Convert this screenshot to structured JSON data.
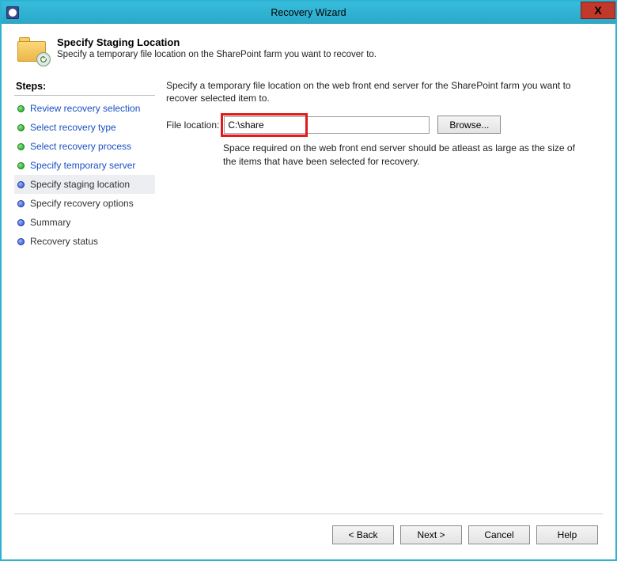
{
  "window": {
    "title": "Recovery Wizard",
    "close": "X"
  },
  "header": {
    "title": "Specify Staging Location",
    "subtitle": "Specify a temporary file location on the SharePoint farm you want to recover to."
  },
  "sidebar": {
    "heading": "Steps:",
    "items": [
      {
        "label": "Review recovery selection",
        "state": "done"
      },
      {
        "label": "Select recovery type",
        "state": "done"
      },
      {
        "label": "Select recovery process",
        "state": "done"
      },
      {
        "label": "Specify temporary server",
        "state": "done"
      },
      {
        "label": "Specify staging location",
        "state": "current"
      },
      {
        "label": "Specify recovery options",
        "state": "pending"
      },
      {
        "label": "Summary",
        "state": "pending"
      },
      {
        "label": "Recovery status",
        "state": "pending"
      }
    ]
  },
  "main": {
    "instruction": "Specify a temporary file location on the web front end server for the SharePoint farm you want to recover selected item to.",
    "file_label": "File location:",
    "file_value": "C:\\share",
    "browse": "Browse...",
    "note": "Space required on the web front end server should be atleast as large as the size of the items that have been selected for recovery."
  },
  "footer": {
    "back": "< Back",
    "next": "Next >",
    "cancel": "Cancel",
    "help": "Help"
  },
  "highlight": {
    "target": "file-location-input"
  }
}
